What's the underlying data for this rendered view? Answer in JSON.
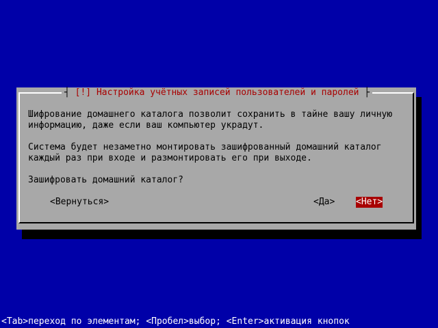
{
  "dialog": {
    "title": "[!] Настройка учётных записей пользователей и паролей",
    "line1": "Шифрование домашнего каталога позволит сохранить в тайне вашу личную",
    "line2": "информацию, даже если ваш компьютер украдут.",
    "line3": "Система будет незаметно монтировать зашифрованный домашний каталог",
    "line4": "каждый раз при входе и размонтировать его при выходе.",
    "question": "Зашифровать домашний каталог?",
    "buttons": {
      "back": "<Вернуться>",
      "yes": "<Да>",
      "no": "<Нет>"
    }
  },
  "help_line": "<Tab>переход по элементам; <Пробел>выбор; <Enter>активация кнопок",
  "colors": {
    "background": "#0000a8",
    "dialog": "#a8a8a8",
    "title_text": "#a80000",
    "selected_button_bg": "#a80000",
    "selected_button_text": "#ffffff"
  }
}
